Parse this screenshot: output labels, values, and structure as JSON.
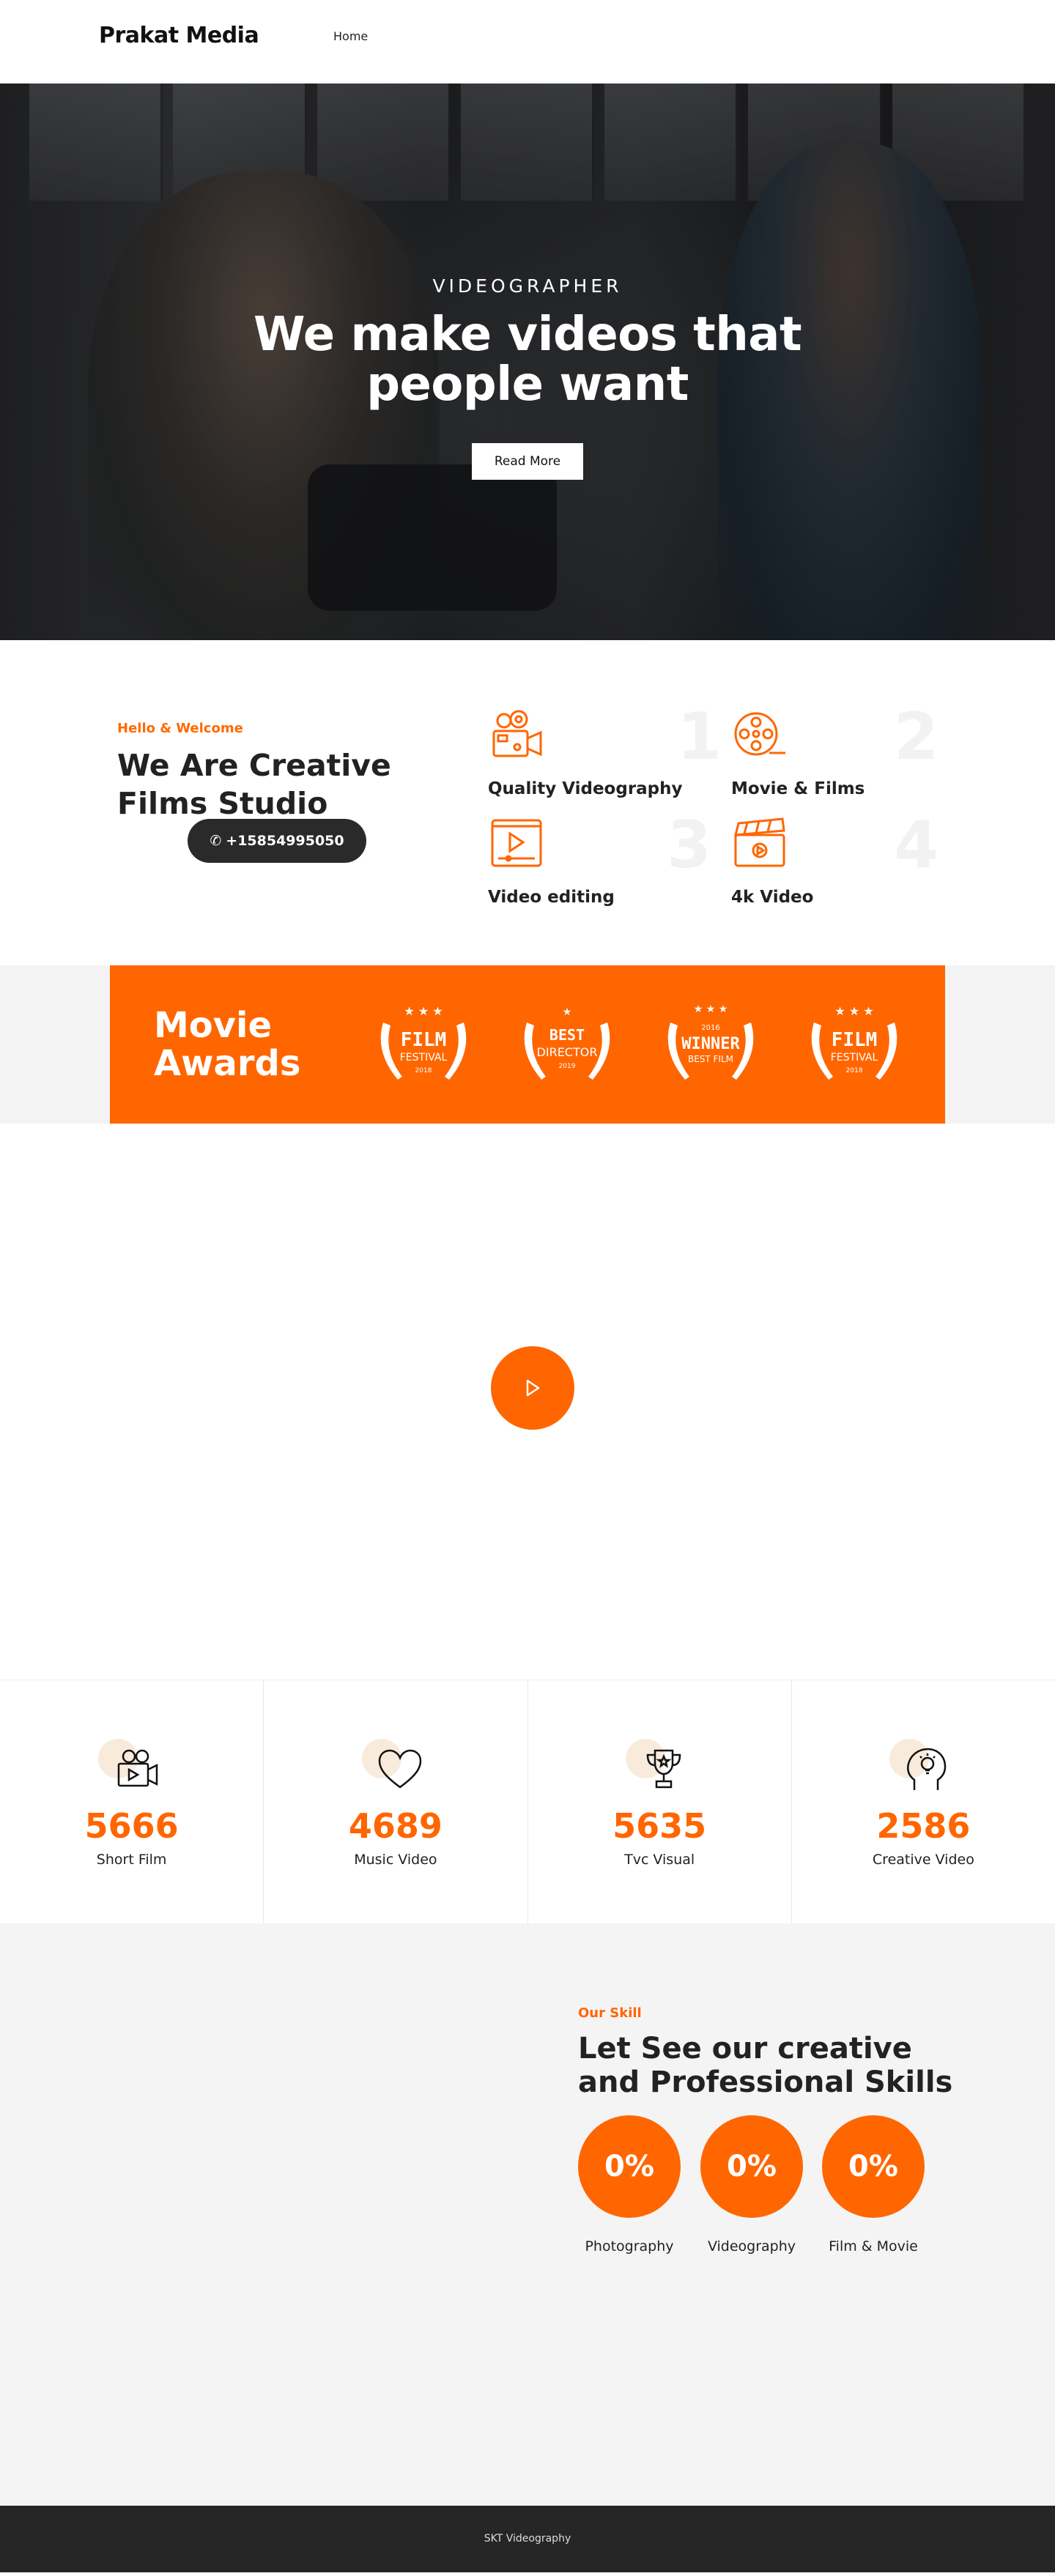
{
  "header": {
    "logo": "Prakat Media",
    "nav": [
      "Home"
    ]
  },
  "hero": {
    "subtitle": "VIDEOGRAPHER",
    "title": "We make videos that people want",
    "button": "Read More"
  },
  "welcome": {
    "eyebrow": "Hello & Welcome",
    "title": "We Are Creative Films Studio",
    "phone": "+15854995050",
    "features": [
      {
        "number": "1",
        "label": "Quality Videography",
        "icon": "video-camera-icon"
      },
      {
        "number": "2",
        "label": "Movie & Films",
        "icon": "film-reel-icon"
      },
      {
        "number": "3",
        "label": "Video editing",
        "icon": "video-player-icon"
      },
      {
        "number": "4",
        "label": "4k Video",
        "icon": "clapperboard-icon"
      }
    ]
  },
  "awards": {
    "title": "Movie Awards",
    "badges": [
      {
        "line1": "FILM",
        "line2": "FESTIVAL",
        "year": "2018"
      },
      {
        "line1": "BEST",
        "line2": "DIRECTOR",
        "year": "2019"
      },
      {
        "line0": "2016",
        "line1": "WINNER",
        "line2": "BEST FILM"
      },
      {
        "line1": "FILM",
        "line2": "FESTIVAL",
        "year": "2018"
      }
    ]
  },
  "stats": [
    {
      "value": "5666",
      "label": "Short Film",
      "icon": "movie-camera-icon"
    },
    {
      "value": "4689",
      "label": "Music Video",
      "icon": "heart-icon"
    },
    {
      "value": "5635",
      "label": "Tvc Visual",
      "icon": "trophy-icon"
    },
    {
      "value": "2586",
      "label": "Creative Video",
      "icon": "idea-head-icon"
    }
  ],
  "skills": {
    "eyebrow": "Our Skill",
    "title": "Let See our creative and Professional Skills",
    "items": [
      {
        "percent": "0%",
        "label": "Photography"
      },
      {
        "percent": "0%",
        "label": "Videography"
      },
      {
        "percent": "0%",
        "label": "Film & Movie"
      }
    ]
  },
  "footer": {
    "text": "SKT Videography"
  },
  "colors": {
    "accent": "#ff6600",
    "dark": "#262626"
  }
}
